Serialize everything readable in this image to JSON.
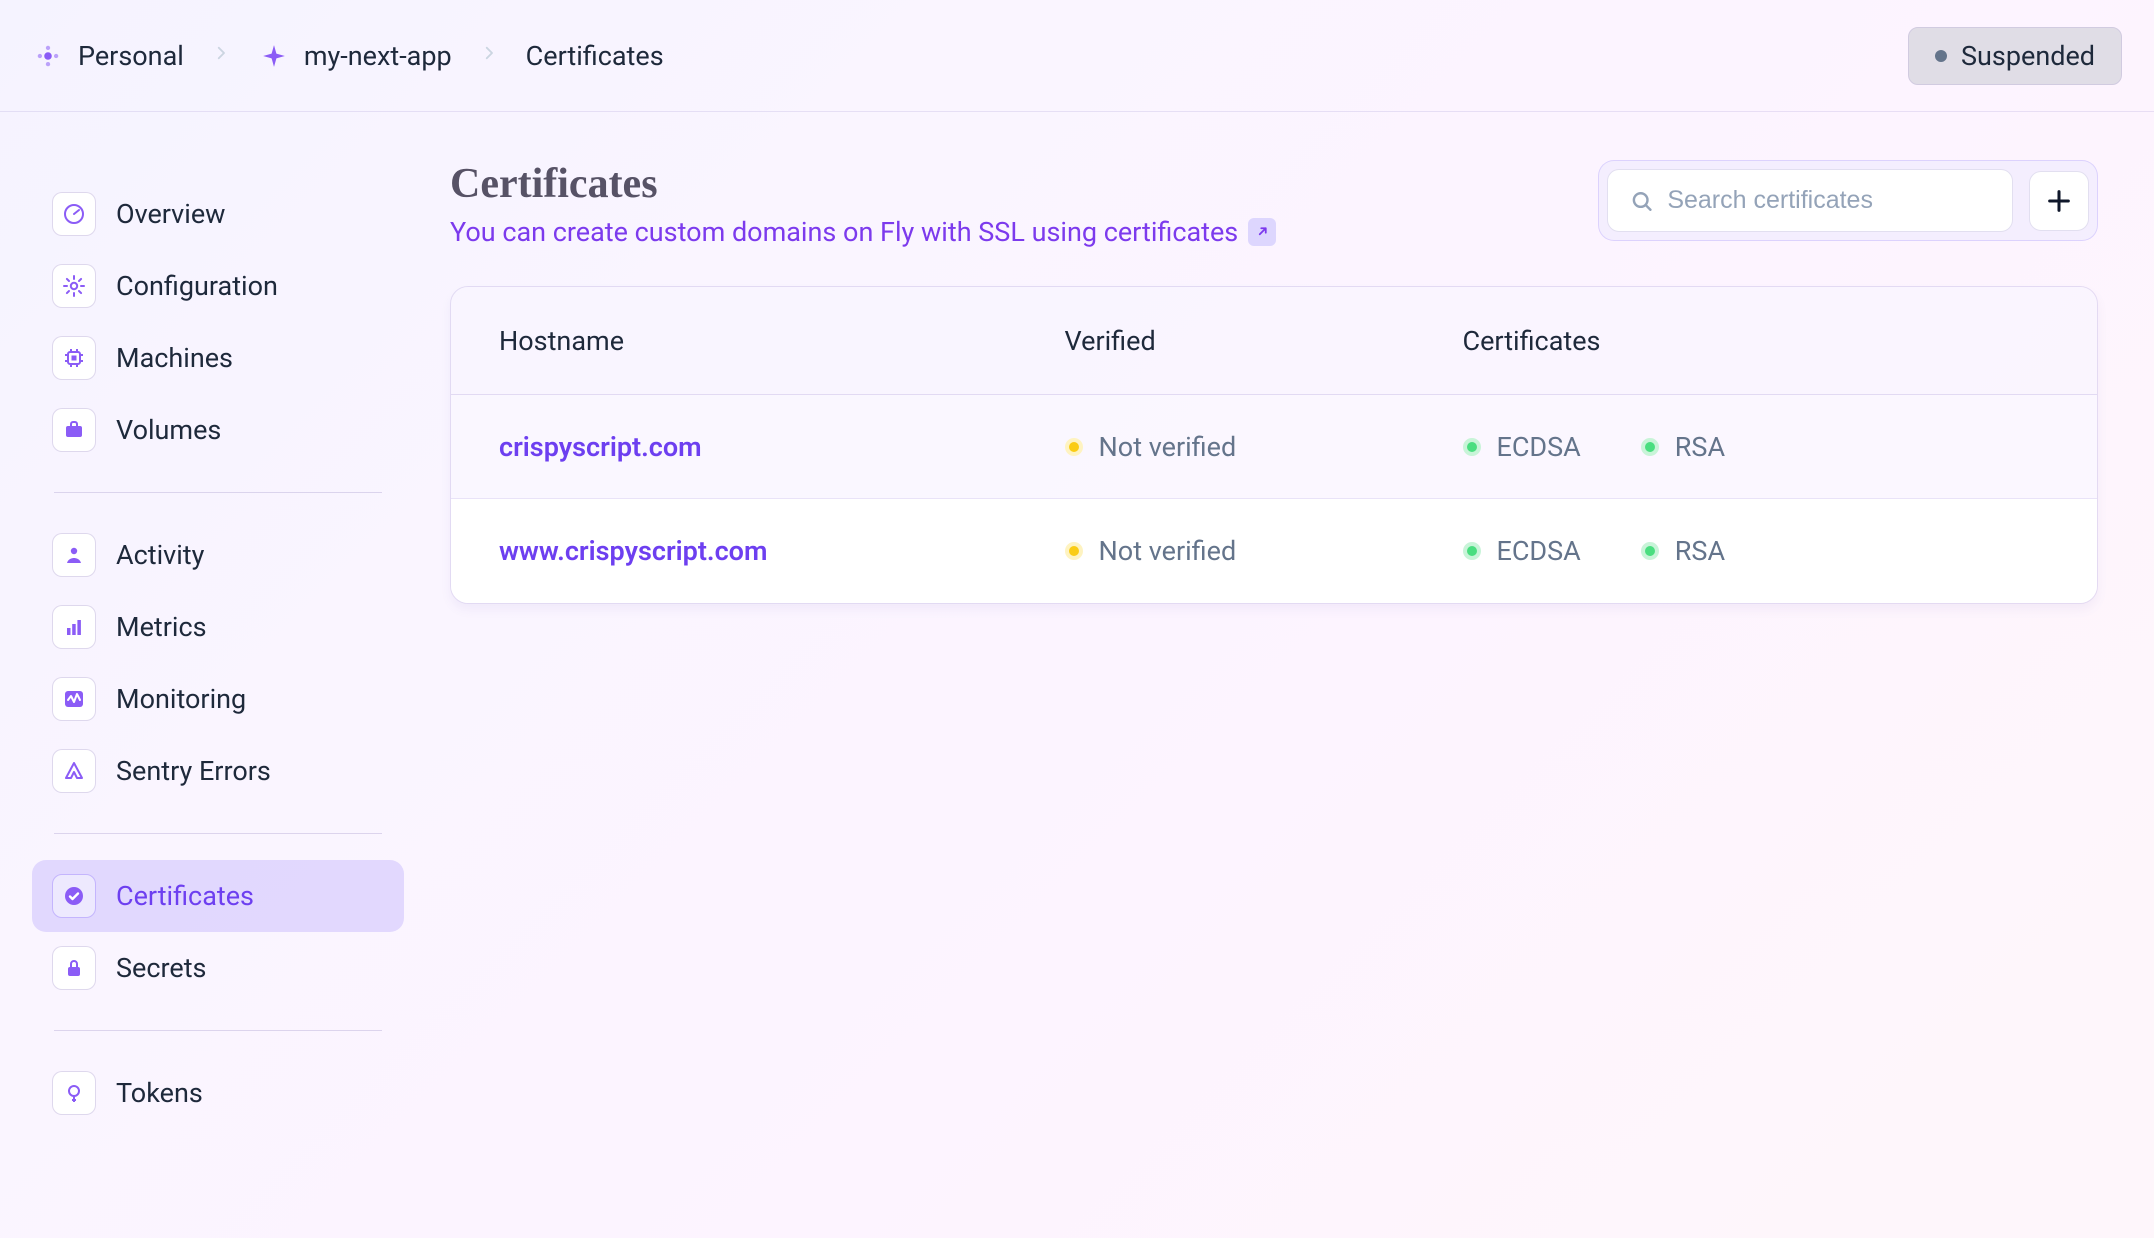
{
  "breadcrumb": {
    "org": "Personal",
    "app": "my-next-app",
    "page": "Certificates"
  },
  "status": {
    "label": "Suspended"
  },
  "sidebar": {
    "groups": [
      [
        {
          "label": "Overview",
          "icon": "gauge",
          "active": false
        },
        {
          "label": "Configuration",
          "icon": "gear",
          "active": false
        },
        {
          "label": "Machines",
          "icon": "cpu",
          "active": false
        },
        {
          "label": "Volumes",
          "icon": "briefcase",
          "active": false
        }
      ],
      [
        {
          "label": "Activity",
          "icon": "person",
          "active": false
        },
        {
          "label": "Metrics",
          "icon": "bars",
          "active": false
        },
        {
          "label": "Monitoring",
          "icon": "wave",
          "active": false
        },
        {
          "label": "Sentry Errors",
          "icon": "sentry",
          "active": false
        }
      ],
      [
        {
          "label": "Certificates",
          "icon": "check",
          "active": true
        },
        {
          "label": "Secrets",
          "icon": "lock",
          "active": false
        }
      ],
      [
        {
          "label": "Tokens",
          "icon": "key",
          "active": false
        }
      ]
    ]
  },
  "page": {
    "title": "Certificates",
    "subtitle": "You can create custom domains on Fly with SSL using certificates"
  },
  "search": {
    "placeholder": "Search certificates"
  },
  "table": {
    "columns": [
      "Hostname",
      "Verified",
      "Certificates"
    ],
    "rows": [
      {
        "hostname": "crispyscript.com",
        "verified_label": "Not verified",
        "verified_color": "yellow",
        "certs": [
          {
            "name": "ECDSA",
            "color": "green"
          },
          {
            "name": "RSA",
            "color": "green"
          }
        ]
      },
      {
        "hostname": "www.crispyscript.com",
        "verified_label": "Not verified",
        "verified_color": "yellow",
        "certs": [
          {
            "name": "ECDSA",
            "color": "green"
          },
          {
            "name": "RSA",
            "color": "green"
          }
        ]
      }
    ]
  }
}
